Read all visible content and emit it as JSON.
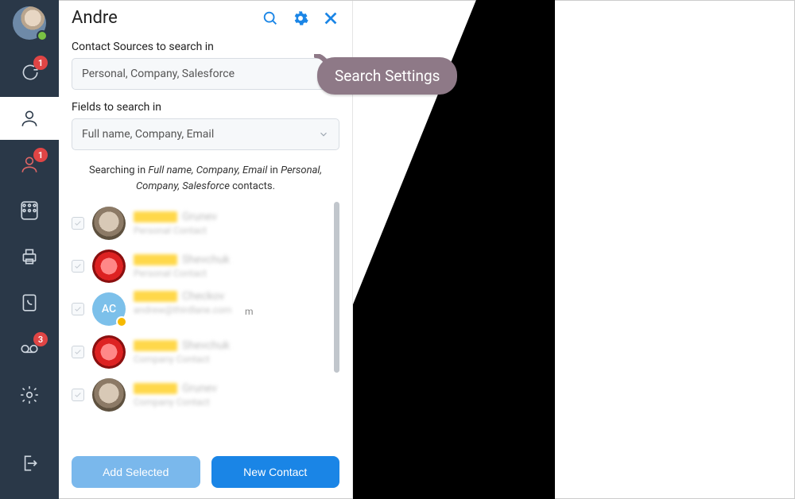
{
  "profile": {
    "status": "online"
  },
  "nav": {
    "chat_badge": "1",
    "contacts_alt_badge": "1",
    "voicemail_badge": "3"
  },
  "panel": {
    "title": "Andre",
    "sources_label": "Contact Sources to search in",
    "sources_value": "Personal, Company, Salesforce",
    "fields_label": "Fields to search in",
    "fields_value": "Full name, Company, Email",
    "hint_prefix": "Searching in ",
    "hint_fields": "Full name, Company, Email",
    "hint_mid": " in ",
    "hint_sources": "Personal, Company, Salesforce",
    "hint_suffix": " contacts."
  },
  "results": [
    {
      "avatar": "cat",
      "initials": "",
      "name_rest": " Grunev",
      "sub": "Personal Contact",
      "yellow": false
    },
    {
      "avatar": "devil",
      "initials": "",
      "name_rest": " Shevchuk",
      "sub": "Personal Contact",
      "yellow": false
    },
    {
      "avatar": "ac",
      "initials": "AC",
      "name_rest": " Checkov",
      "sub": "andrew@thirdlane.com",
      "subplain": "m",
      "yellow": true
    },
    {
      "avatar": "devil",
      "initials": "",
      "name_rest": " Shevchuk",
      "sub": "Company Contact",
      "yellow": false
    },
    {
      "avatar": "cat",
      "initials": "",
      "name_rest": " Grunev",
      "sub": "Company Contact",
      "yellow": false
    }
  ],
  "footer": {
    "add_selected": "Add Selected",
    "new_contact": "New Contact"
  },
  "tooltip": {
    "text": "Search Settings"
  }
}
